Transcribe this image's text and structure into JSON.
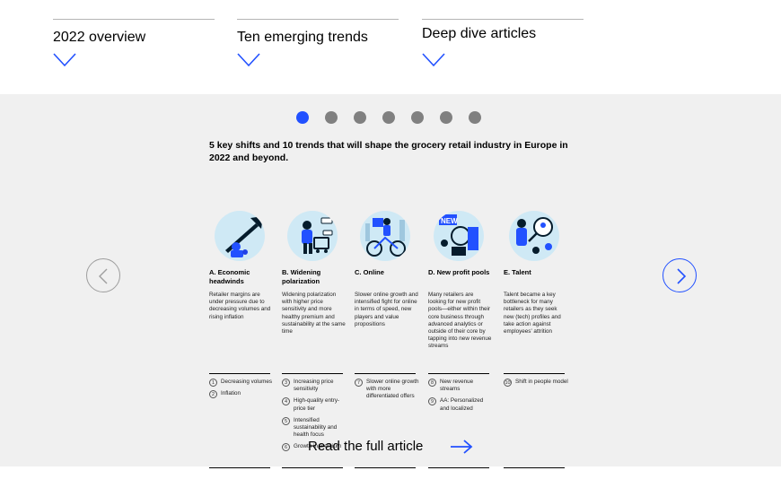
{
  "nav": {
    "items": [
      {
        "label": "2022 overview"
      },
      {
        "label": "Ten emerging trends"
      },
      {
        "label": "Deep dive articles"
      }
    ]
  },
  "carousel": {
    "slide_count": 7,
    "active_index": 0
  },
  "infographic": {
    "title": "5 key shifts and 10 trends that will shape the grocery retail industry in Europe in 2022 and beyond.",
    "shifts": [
      {
        "title": "A. Economic headwinds",
        "description": "Retailer margins are under pressure due to decreasing volumes and rising inflation",
        "icon": "rising-arrow-icon",
        "trends": [
          {
            "num": "1",
            "label": "Decreasing volumes"
          },
          {
            "num": "2",
            "label": "Inflation"
          }
        ]
      },
      {
        "title": "B. Widening polarization",
        "description": "Widening polarization with higher price sensitivity and more healthy premium and sustainability at the same time",
        "icon": "shopper-icon",
        "trends": [
          {
            "num": "3",
            "label": "Increasing price sensitivity"
          },
          {
            "num": "4",
            "label": "High-quality entry-price tier"
          },
          {
            "num": "5",
            "label": "Intensified sustainability and health focus"
          },
          {
            "num": "6",
            "label": "Growth in premium"
          }
        ]
      },
      {
        "title": "C. Online",
        "description": "Slower online growth and intensified fight for online in terms of speed, new players and value propositions",
        "icon": "delivery-bike-icon",
        "trends": [
          {
            "num": "7",
            "label": "Slower online growth with more differentiated offers"
          }
        ]
      },
      {
        "title": "D. New profit pools",
        "description": "Many retailers are looking for new profit pools—either within their core business through advanced analytics or outside of their core by tapping into new revenue streams",
        "icon": "new-profit-icon",
        "new_tag": "NEW",
        "trends": [
          {
            "num": "8",
            "label": "New revenue streams"
          },
          {
            "num": "9",
            "label": "AA: Personalized and localized"
          }
        ]
      },
      {
        "title": "E. Talent",
        "description": "Talent became a key bottleneck for many retailers as they seek new (tech) profiles and take action against employees' attrition",
        "icon": "talent-search-icon",
        "trends": [
          {
            "num": "10",
            "label": "Shift in people model"
          }
        ]
      }
    ]
  },
  "cta": {
    "label": "Read the full article"
  },
  "colors": {
    "accent": "#2251ff",
    "panel": "#f0f0f0",
    "dot_inactive": "#808080",
    "circle_bg": "#cfe9f5",
    "icon_dark": "#051c2c"
  }
}
